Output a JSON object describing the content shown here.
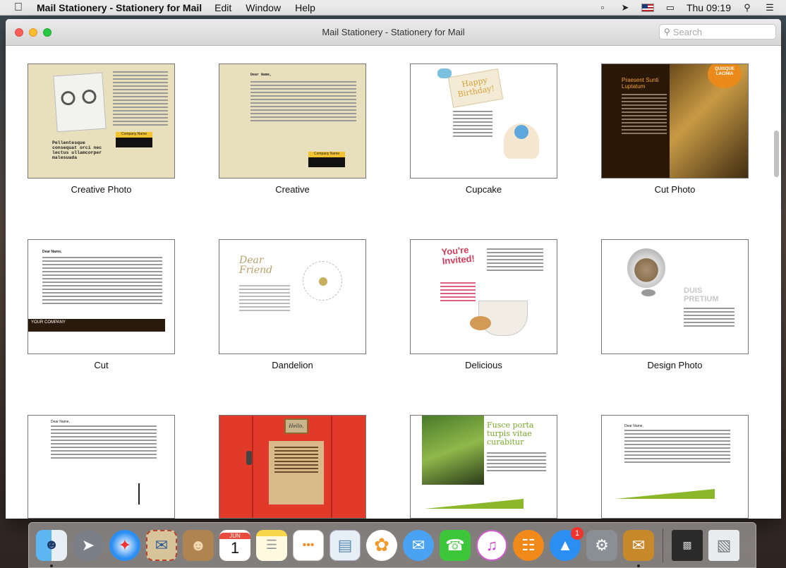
{
  "menubar": {
    "app_name": "Mail Stationery - Stationery for Mail",
    "items": [
      "Edit",
      "Window",
      "Help"
    ],
    "clock": "Thu 09:19"
  },
  "window": {
    "title": "Mail Stationery - Stationery for Mail",
    "search_placeholder": "Search"
  },
  "templates": [
    {
      "label": "Creative Photo",
      "text": "Pellentesque consequat orci nec lectus ullamcorper malesuada",
      "tag": "Company Name"
    },
    {
      "label": "Creative",
      "text": "Dear Name,",
      "tag": "Company Name"
    },
    {
      "label": "Cupcake",
      "text": "Happy Birthday!"
    },
    {
      "label": "Cut Photo",
      "text": "Praesent Sunti Luptatum",
      "tag": "QUISQUE LACINIA"
    },
    {
      "label": "Cut",
      "text": "Dear Name,",
      "tag": "YOUR COMPANY"
    },
    {
      "label": "Dandelion",
      "text": "Dear Friend"
    },
    {
      "label": "Delicious",
      "text": "You're Invited!"
    },
    {
      "label": "Design Photo",
      "text": "DUIS PRETIUM"
    },
    {
      "label": "",
      "text": "Dear Name,"
    },
    {
      "label": "",
      "text": "Hello,"
    },
    {
      "label": "",
      "text": "Fusce porta turpis vitae curabitur"
    },
    {
      "label": "",
      "text": "Dear Name,"
    }
  ],
  "dock": {
    "icons": [
      "finder-icon",
      "launchpad-icon",
      "safari-icon",
      "mail-icon",
      "contacts-icon",
      "calendar-icon",
      "notes-icon",
      "reminders-icon",
      "preview-icon",
      "photos-icon",
      "messages-icon",
      "facetime-icon",
      "itunes-icon",
      "ibooks-icon",
      "app-store-icon",
      "system-preferences-icon",
      "mail-stationery-icon",
      "minimized-window-icon",
      "trash-icon"
    ],
    "calendar_month": "JUN",
    "calendar_day": "1",
    "app_store_badge": "1"
  }
}
